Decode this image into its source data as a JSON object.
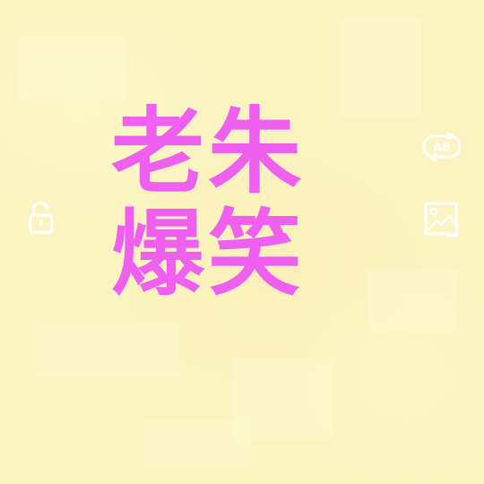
{
  "post": {
    "title_line1": "老朱",
    "title_line2": "爆笑"
  },
  "icons": {
    "left": "unlock-icon",
    "right_top": "ab-swap-icon",
    "right_bottom": "image-icon"
  },
  "colors": {
    "background": "#fbf3c0",
    "title": "#f060f0",
    "icon": "#ffffff"
  }
}
